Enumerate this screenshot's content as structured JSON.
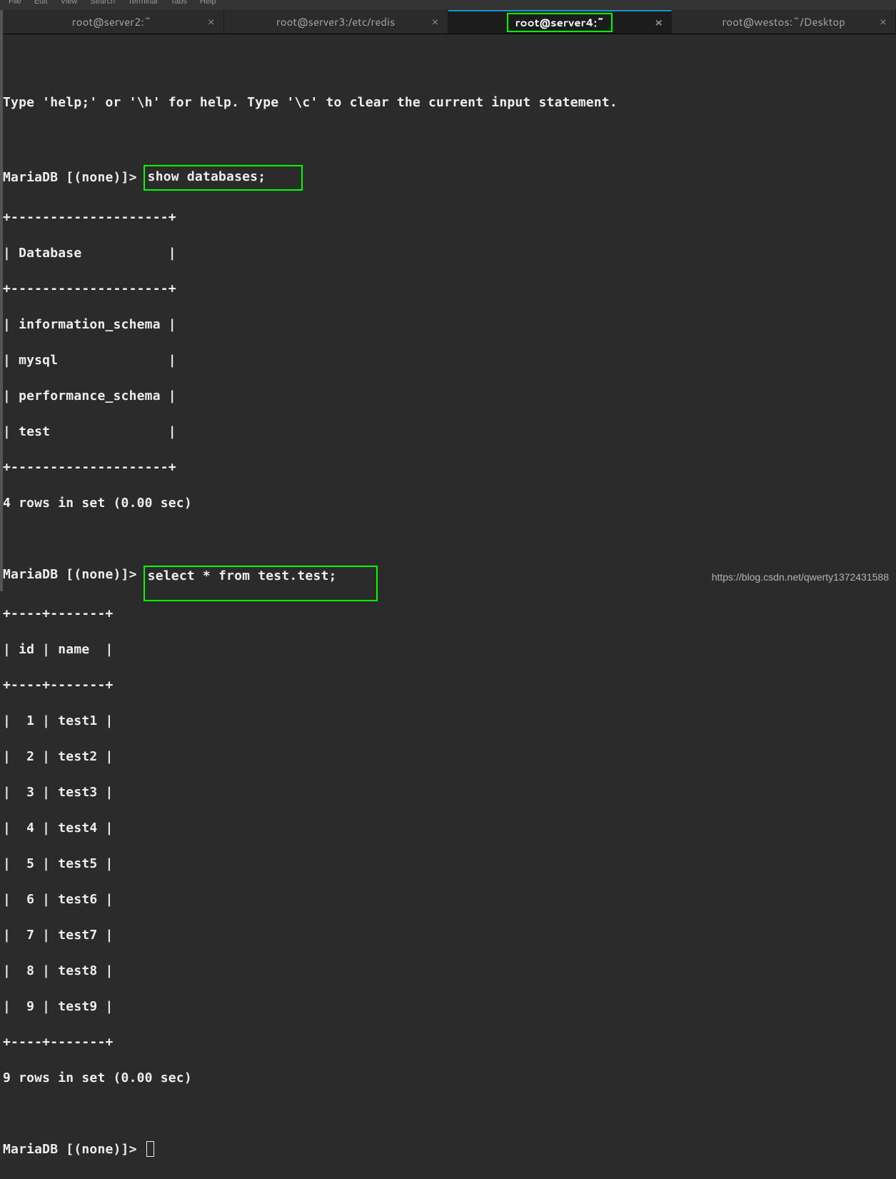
{
  "menubar": [
    "File",
    "Edit",
    "View",
    "Search",
    "Terminal",
    "Tabs",
    "Help"
  ],
  "tabs": [
    {
      "title": "root@server2:~",
      "active": false
    },
    {
      "title": "root@server3:/etc/redis",
      "active": false
    },
    {
      "title": "root@server4:~",
      "active": true
    },
    {
      "title": "root@westos:~/Desktop",
      "active": false
    }
  ],
  "help_line": "Type 'help;' or '\\h' for help. Type '\\c' to clear the current input statement.",
  "prompt": "MariaDB [(none)]> ",
  "command1": "show databases;",
  "db_border": "+--------------------+",
  "db_header": "| Database           |",
  "db_rows": [
    "| information_schema |",
    "| mysql              |",
    "| performance_schema |",
    "| test               |"
  ],
  "result1": "4 rows in set (0.00 sec)",
  "command2": "select * from test.test;",
  "tbl_border": "+----+-------+",
  "tbl_header": "| id | name  |",
  "tbl_rows": [
    "|  1 | test1 |",
    "|  2 | test2 |",
    "|  3 | test3 |",
    "|  4 | test4 |",
    "|  5 | test5 |",
    "|  6 | test6 |",
    "|  7 | test7 |",
    "|  8 | test8 |",
    "|  9 | test9 |"
  ],
  "result2": "9 rows in set (0.00 sec)",
  "watermark": "https://blog.csdn.net/qwerty1372431588"
}
